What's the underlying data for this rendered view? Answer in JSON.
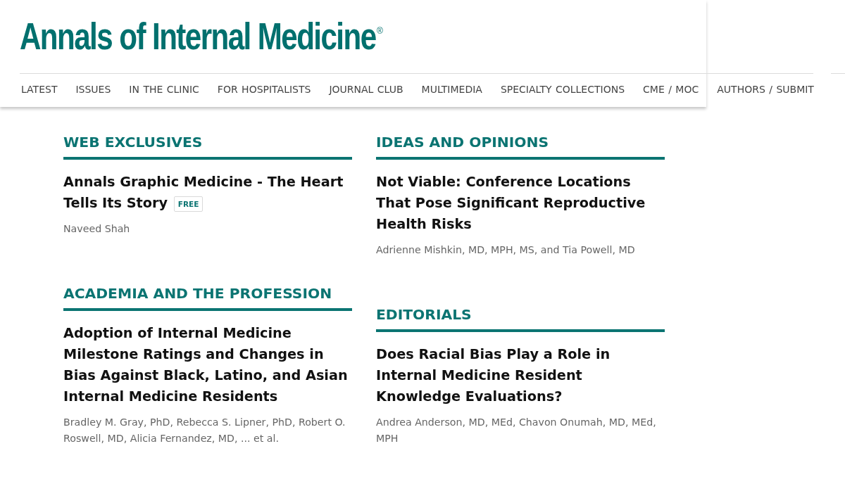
{
  "logo": {
    "title": "Annals of Internal Medicine",
    "mark": "®"
  },
  "nav": [
    {
      "label": "LATEST"
    },
    {
      "label": "ISSUES"
    },
    {
      "label": "IN THE CLINIC"
    },
    {
      "label": "FOR HOSPITALISTS"
    },
    {
      "label": "JOURNAL CLUB"
    },
    {
      "label": "MULTIMEDIA"
    },
    {
      "label": "SPECIALTY COLLECTIONS"
    },
    {
      "label": "CME / MOC"
    },
    {
      "label": "AUTHORS / SUBMIT"
    }
  ],
  "columns": [
    {
      "sections": [
        {
          "heading": "WEB EXCLUSIVES",
          "articles": [
            {
              "title": "Annals Graphic Medicine - The Heart Tells Its Story",
              "badge": "FREE",
              "authors": "Naveed Shah"
            }
          ]
        },
        {
          "heading": "ACADEMIA AND THE PROFESSION",
          "articles": [
            {
              "title": "Adoption of Internal Medicine Milestone Ratings and Changes in Bias Against Black, Latino, and Asian Internal Medicine Residents",
              "authors": "Bradley M. Gray, PhD, Rebecca S. Lipner, PhD, Robert O. Roswell, MD, Alicia Fernandez, MD, ... et al."
            }
          ]
        }
      ]
    },
    {
      "sections": [
        {
          "heading": "IDEAS AND OPINIONS",
          "articles": [
            {
              "title": "Not Viable: Conference Locations That Pose Significant Reproductive Health Risks",
              "authors": "Adrienne Mishkin, MD, MPH, MS, and Tia Powell, MD"
            }
          ]
        },
        {
          "heading": "EDITORIALS",
          "articles": [
            {
              "title": "Does Racial Bias Play a Role in Internal Medicine Resident Knowledge Evaluations?",
              "authors": "Andrea Anderson, MD, MEd, Chavon Onumah, MD, MEd, MPH"
            }
          ]
        }
      ]
    }
  ]
}
